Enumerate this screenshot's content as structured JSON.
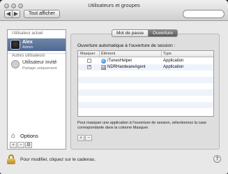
{
  "window": {
    "title": "Utilisateurs et groupes",
    "show_all_label": "Tout afficher",
    "back_symbol": "◀",
    "forward_symbol": "▶"
  },
  "sidebar": {
    "current_user_header": "Utilisateur actuel",
    "current_user": {
      "name": "Alex",
      "role": "Admin"
    },
    "other_users_header": "Autres utilisateurs",
    "guest": {
      "name": "Utilisateur invité",
      "subtitle": "Partage uniquement"
    },
    "options_label": "Options",
    "tools": [
      "+",
      "−",
      "⚙"
    ]
  },
  "tabs": [
    {
      "label": "Mot de passe",
      "active": false
    },
    {
      "label": "Ouverture",
      "active": true
    }
  ],
  "login_items": {
    "title": "Ouverture automatique à l'ouverture de session :",
    "columns": {
      "hide": "Masquer",
      "item": "Élément",
      "type": "Type"
    },
    "rows": [
      {
        "hidden": false,
        "name": "iTunesHelper",
        "type": "Application",
        "icon": "itunes-icon"
      },
      {
        "hidden": true,
        "name": "NDRHardwareAgent",
        "type": "Application",
        "icon": "app-icon"
      }
    ],
    "hint": "Pour masquer une application à l'ouverture de session, sélectionnez la case correspondante dans la colonne Masquer.",
    "tools": [
      "+",
      "−"
    ]
  },
  "footer": {
    "lock_text": "Pour modifier, cliquez sur le cadenas.",
    "help_label": "?"
  },
  "colors": {
    "selection": "#5d769c",
    "lock": "#c9a23a"
  }
}
